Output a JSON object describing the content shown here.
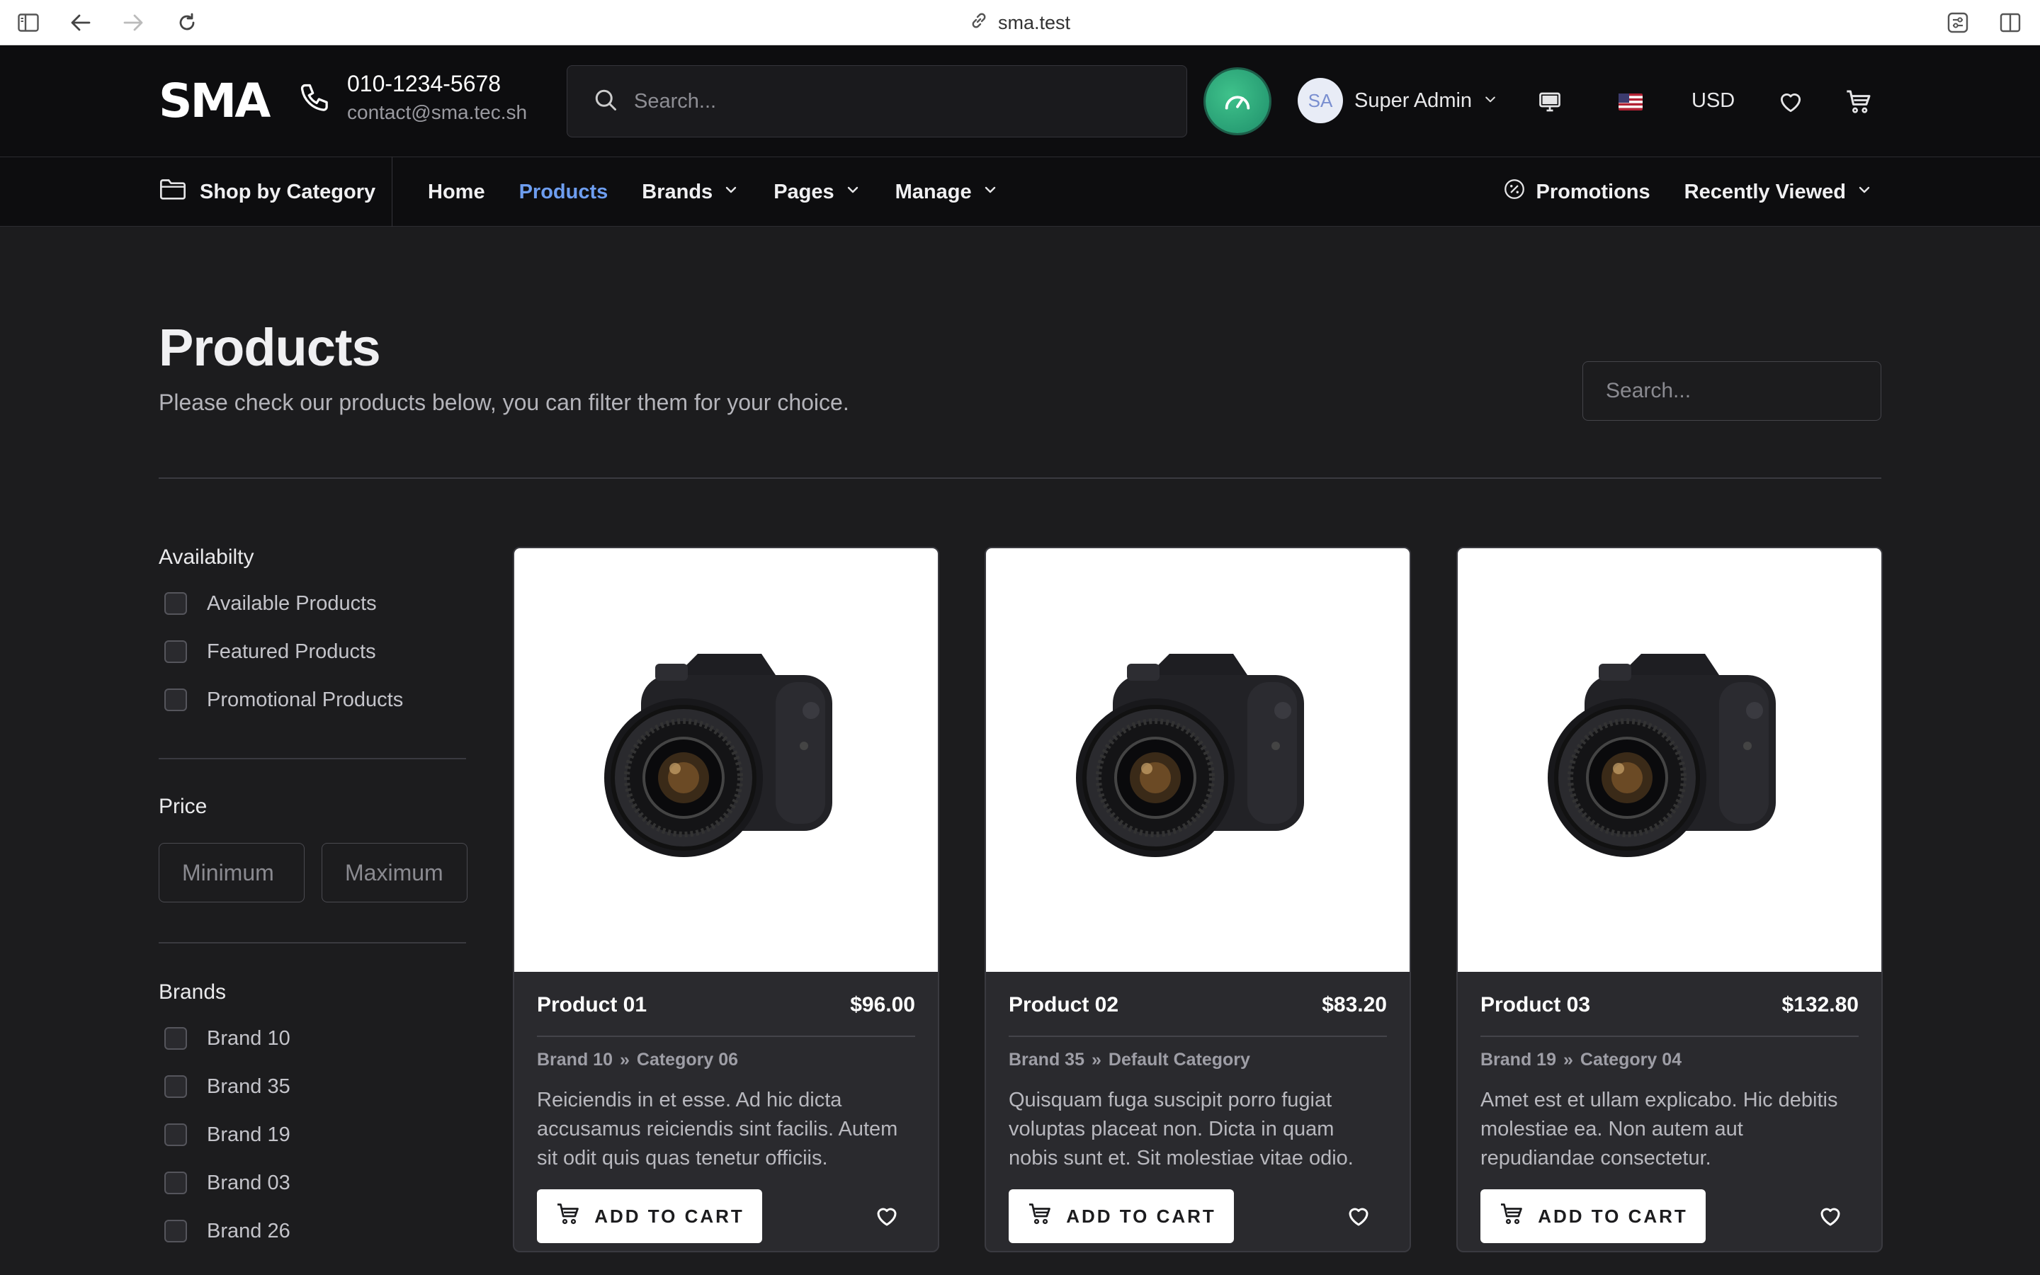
{
  "browser": {
    "url": "sma.test"
  },
  "header": {
    "logo": "SMA",
    "phone": "010-1234-5678",
    "email": "contact@sma.tec.sh",
    "search_placeholder": "Search...",
    "user_initials": "SA",
    "user_name": "Super Admin",
    "currency": "USD"
  },
  "nav": {
    "shop_by_category": "Shop by Category",
    "items": [
      {
        "label": "Home"
      },
      {
        "label": "Products"
      },
      {
        "label": "Brands"
      },
      {
        "label": "Pages"
      },
      {
        "label": "Manage"
      }
    ],
    "promotions": "Promotions",
    "recently_viewed": "Recently Viewed"
  },
  "page": {
    "title": "Products",
    "subtitle": "Please check our products below, you can filter them for your choice.",
    "search_placeholder": "Search..."
  },
  "filters": {
    "availability": {
      "title": "Availabilty",
      "options": [
        "Available Products",
        "Featured Products",
        "Promotional Products"
      ]
    },
    "price": {
      "title": "Price",
      "min_placeholder": "Minimum",
      "max_placeholder": "Maximum"
    },
    "brands": {
      "title": "Brands",
      "options": [
        "Brand 10",
        "Brand 35",
        "Brand 19",
        "Brand 03",
        "Brand 26"
      ]
    }
  },
  "products": [
    {
      "name": "Product 01",
      "price": "$96.00",
      "brand": "Brand 10",
      "separator": "»",
      "category": "Category 06",
      "description": "Reiciendis in et esse. Ad hic dicta accusamus reiciendis sint facilis. Autem sit odit quis quas tenetur officiis.",
      "cta": "ADD TO CART"
    },
    {
      "name": "Product 02",
      "price": "$83.20",
      "brand": "Brand 35",
      "separator": "»",
      "category": "Default Category",
      "description": "Quisquam fuga suscipit porro fugiat voluptas placeat non. Dicta in quam nobis sunt et. Sit molestiae vitae odio.",
      "cta": "ADD TO CART"
    },
    {
      "name": "Product 03",
      "price": "$132.80",
      "brand": "Brand 19",
      "separator": "»",
      "category": "Category 04",
      "description": "Amet est et ullam explicabo. Hic debitis molestiae ea. Non autem aut repudiandae consectetur.",
      "cta": "ADD TO CART"
    }
  ],
  "icons": {
    "chrome_left": [
      "sidebar-toggle-icon",
      "back-icon",
      "forward-icon",
      "reload-icon"
    ],
    "chrome_right": [
      "extensions-icon",
      "split-view-icon"
    ],
    "header": [
      "phone-icon",
      "search-icon",
      "gauge-icon",
      "monitor-icon",
      "us-flag-icon",
      "heart-icon",
      "cart-icon"
    ]
  },
  "colors": {
    "accent": "#6e9ef0",
    "background": "#1c1c1e",
    "header": "#0d0d0f",
    "gauge": "#2aa876"
  }
}
